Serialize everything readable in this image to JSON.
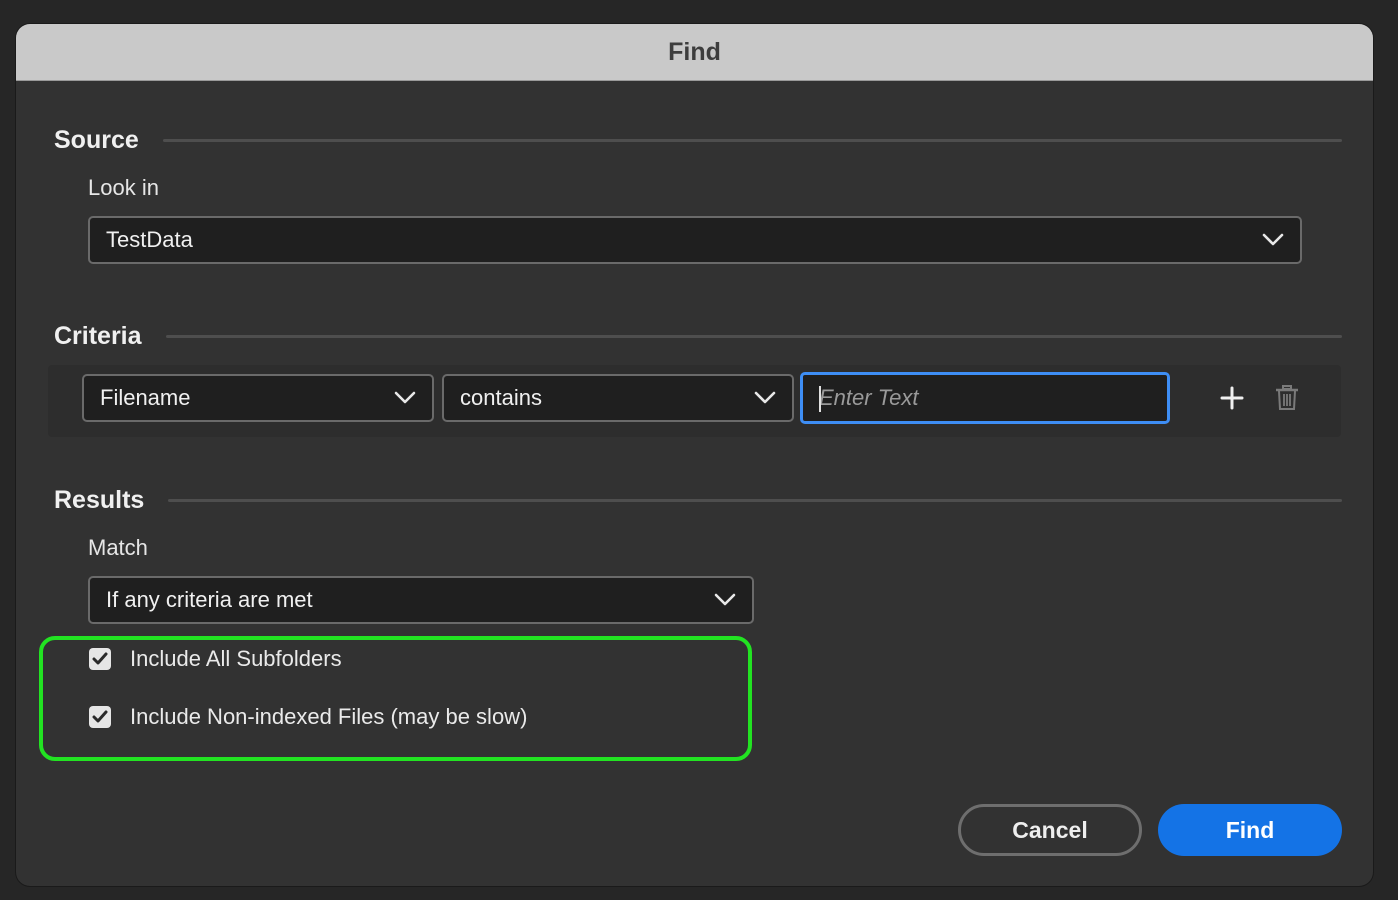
{
  "dialog": {
    "title": "Find",
    "source": {
      "heading": "Source",
      "look_in_label": "Look in",
      "look_in_value": "TestData"
    },
    "criteria": {
      "heading": "Criteria",
      "field_value": "Filename",
      "operator_value": "contains",
      "text_placeholder": "Enter Text",
      "text_value": ""
    },
    "results": {
      "heading": "Results",
      "match_label": "Match",
      "match_value": "If any criteria are met",
      "include_subfolders": {
        "label": "Include All Subfolders",
        "checked": true
      },
      "include_nonindexed": {
        "label": "Include Non-indexed Files (may be slow)",
        "checked": true
      }
    },
    "buttons": {
      "cancel": "Cancel",
      "find": "Find"
    },
    "colors": {
      "accent": "#1473e6",
      "focus_ring": "#3e8ef5",
      "highlight": "#22e322"
    }
  }
}
